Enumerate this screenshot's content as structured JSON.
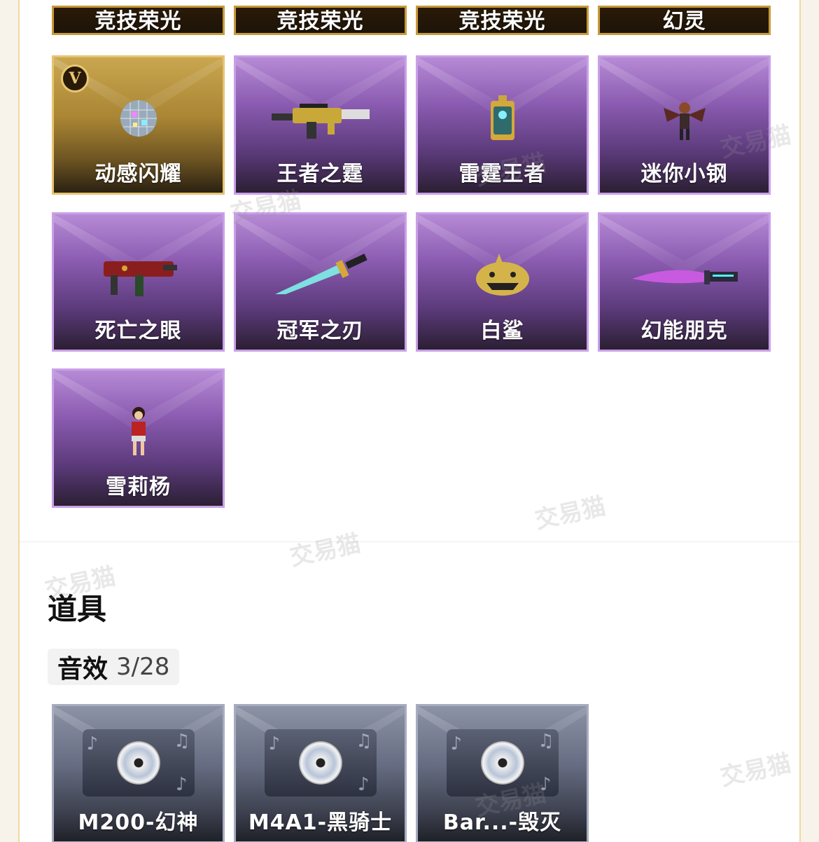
{
  "top_row": [
    "竞技荣光",
    "竞技荣光",
    "竞技荣光",
    "幻灵"
  ],
  "items": [
    {
      "label": "动感闪耀",
      "style": "gold",
      "icon": "disco-ball-icon",
      "badge": "V"
    },
    {
      "label": "王者之霆",
      "style": "purple",
      "icon": "rifle-icon"
    },
    {
      "label": "雷霆王者",
      "style": "purple",
      "icon": "grenade-icon"
    },
    {
      "label": "迷你小钢",
      "style": "purple",
      "icon": "winged-figure-icon"
    },
    {
      "label": "死亡之眼",
      "style": "purple",
      "icon": "smg-icon"
    },
    {
      "label": "冠军之刃",
      "style": "purple",
      "icon": "knife-icon"
    },
    {
      "label": "白鲨",
      "style": "purple",
      "icon": "shark-icon"
    },
    {
      "label": "幻能朋克",
      "style": "purple",
      "icon": "knife-icon"
    },
    {
      "label": "雪莉杨",
      "style": "purple",
      "icon": "character-icon"
    }
  ],
  "section": {
    "title": "道具"
  },
  "category": {
    "name": "音效",
    "count": "3/28"
  },
  "sound_items": [
    {
      "label": "M200-幻神"
    },
    {
      "label": "M4A1-黑骑士"
    },
    {
      "label": "Bar...-毁灭"
    }
  ],
  "watermark": "交易猫",
  "colors": {
    "panel_border": "#f0d8a0",
    "purple_card": "#8a5bb0",
    "gold_card": "#a98534",
    "grey_card": "#656b80"
  }
}
